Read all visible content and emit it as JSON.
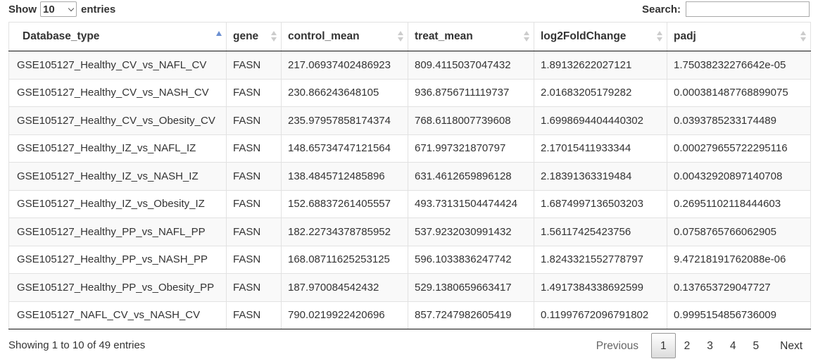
{
  "length_menu": {
    "show_label": "Show",
    "selected": "10",
    "entries_label": "entries"
  },
  "search": {
    "label": "Search:",
    "value": "",
    "placeholder": ""
  },
  "table": {
    "columns": [
      "Database_type",
      "gene",
      "control_mean",
      "treat_mean",
      "log2FoldChange",
      "padj"
    ],
    "sort": {
      "column": "Database_type",
      "direction": "ascending"
    },
    "rows": [
      [
        "GSE105127_Healthy_CV_vs_NAFL_CV",
        "FASN",
        "217.06937402486923",
        "809.4115037047432",
        "1.89132622027121",
        "1.75038232276642e-05"
      ],
      [
        "GSE105127_Healthy_CV_vs_NASH_CV",
        "FASN",
        "230.866243648105",
        "936.8756711119737",
        "2.01683205179282",
        "0.000381487768899075"
      ],
      [
        "GSE105127_Healthy_CV_vs_Obesity_CV",
        "FASN",
        "235.97957858174374",
        "768.6118007739608",
        "1.6998694404440302",
        "0.0393785233174489"
      ],
      [
        "GSE105127_Healthy_IZ_vs_NAFL_IZ",
        "FASN",
        "148.65734747121564",
        "671.997321870797",
        "2.17015411933344",
        "0.000279655722295116"
      ],
      [
        "GSE105127_Healthy_IZ_vs_NASH_IZ",
        "FASN",
        "138.4845712485896",
        "631.4612659896128",
        "2.18391363319484",
        "0.00432920897140708"
      ],
      [
        "GSE105127_Healthy_IZ_vs_Obesity_IZ",
        "FASN",
        "152.68837261405557",
        "493.73131504474424",
        "1.6874997136503203",
        "0.26951102118444603"
      ],
      [
        "GSE105127_Healthy_PP_vs_NAFL_PP",
        "FASN",
        "182.22734378785952",
        "537.9232030991432",
        "1.56117425423756",
        "0.0758765766062905"
      ],
      [
        "GSE105127_Healthy_PP_vs_NASH_PP",
        "FASN",
        "168.08711625253125",
        "596.1033836247742",
        "1.8243321552778797",
        "9.47218191762088e-06"
      ],
      [
        "GSE105127_Healthy_PP_vs_Obesity_PP",
        "FASN",
        "187.970084542432",
        "529.1380659663417",
        "1.4917384338692599",
        "0.137653729047727"
      ],
      [
        "GSE105127_NAFL_CV_vs_NASH_CV",
        "FASN",
        "790.0219922420696",
        "857.7247982605419",
        "0.11997672096791802",
        "0.9995154856736009"
      ]
    ]
  },
  "info": "Showing 1 to 10 of 49 entries",
  "pagination": {
    "previous": "Previous",
    "pages": [
      "1",
      "2",
      "3",
      "4",
      "5"
    ],
    "current": "1",
    "next": "Next"
  },
  "colors": {
    "sort_active": "#6b8fd1",
    "sort_inactive": "#cccccc",
    "row_stripe": "#f9f9f9"
  }
}
